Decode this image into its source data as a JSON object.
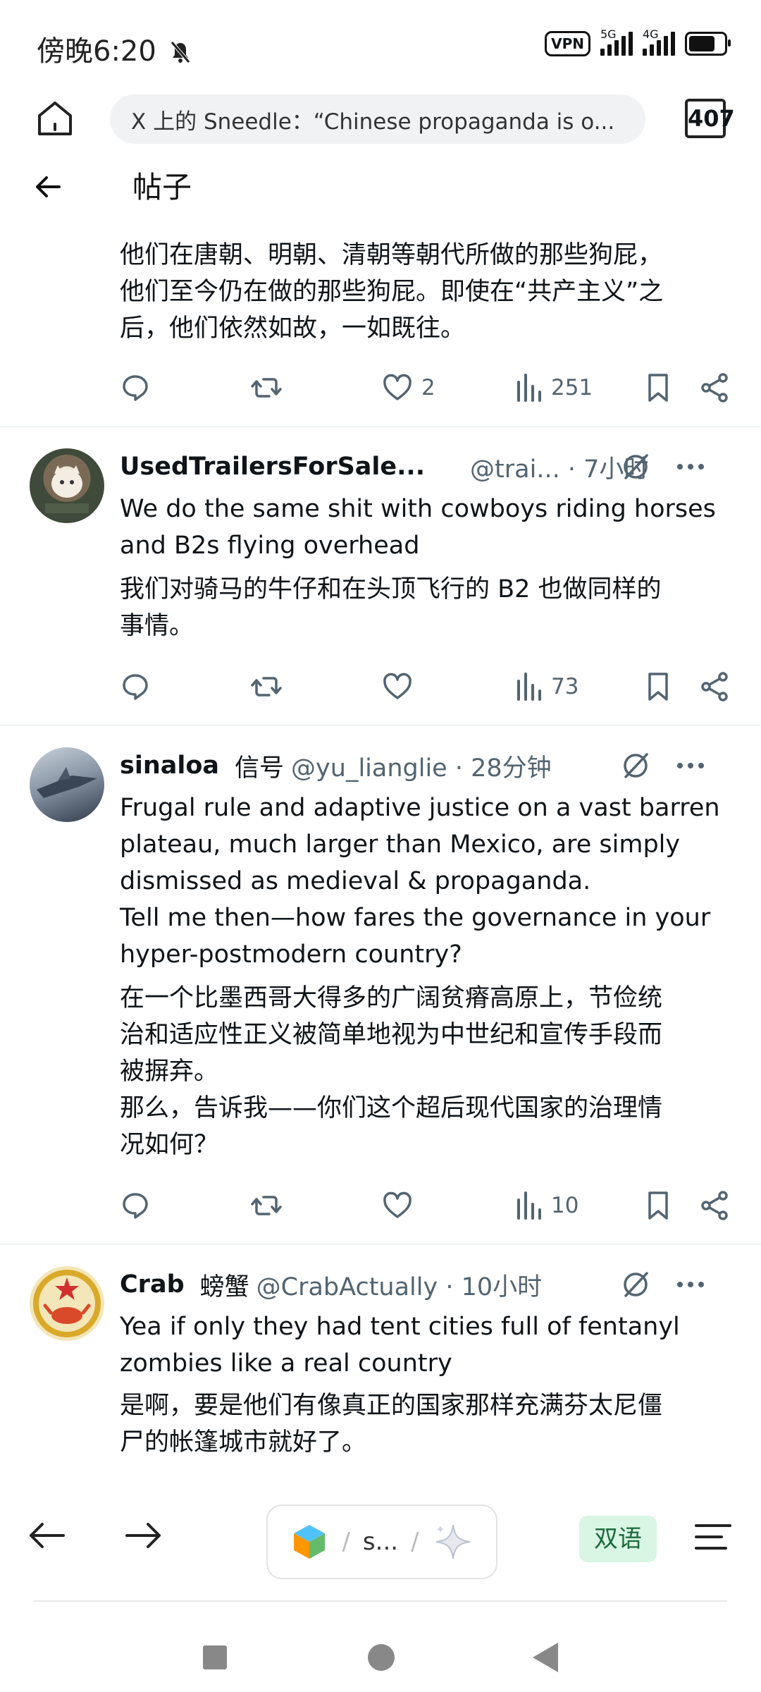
{
  "status_bar": {
    "time": "傍晚6:20",
    "vpn_label": "VPN",
    "signal_1_label": "5G",
    "signal_2_label": "4G"
  },
  "browser": {
    "url_title": "X 上的 Sneedle：“Chinese propaganda is o...",
    "tab_count": "407"
  },
  "header": {
    "title": "帖子"
  },
  "top_post": {
    "translation": "他们在唐朝、明朝、清朝等朝代所做的那些狗屁，\n他们至今仍在做的那些狗屁。即使在“共产主义”之\n后，他们依然如故，一如既往。",
    "likes": "2",
    "views": "251"
  },
  "posts": [
    {
      "name": "UsedTrailersForSale...",
      "translated_name": "",
      "handle": "@trai... · 7小时",
      "text": "We do the same shit with cowboys riding horses\nand B2s flying overhead",
      "translation": "我们对骑马的牛仔和在头顶飞行的 B2 也做同样的\n事情。",
      "likes": "",
      "views": "73"
    },
    {
      "name": "sinaloa",
      "translated_name": "信号",
      "handle": "@yu_lianglie · 28分钟",
      "text": "Frugal rule and adaptive justice on a vast barren\nplateau, much larger than Mexico, are simply\ndismissed as medieval & propaganda.\nTell me then—how fares the governance in your\nhyper-postmodern country?",
      "translation": "在一个比墨西哥大得多的广阔贫瘠高原上，节俭统\n治和适应性正义被简单地视为中世纪和宣传手段而\n被摒弃。\n那么，告诉我——你们这个超后现代国家的治理情\n况如何？",
      "likes": "",
      "views": "10"
    },
    {
      "name": "Crab",
      "translated_name": "螃蟹",
      "handle": "@CrabActually · 10小时",
      "text": "Yea if only they had tent cities full of fentanyl\nzombies like a real country",
      "translation": "是啊，要是他们有像真正的国家那样充满芬太尼僵\n尸的帐篷城市就好了。"
    }
  ],
  "bottom_toolbar": {
    "pill_text": "s...",
    "pill_sep": "/",
    "bilingual_label": "双语"
  },
  "colors": {
    "text": "#0f1419",
    "muted": "#536471",
    "bilingual_bg": "#d9f5e4",
    "bilingual_fg": "#1d6b3e",
    "url_bg": "#f0f2f4"
  }
}
